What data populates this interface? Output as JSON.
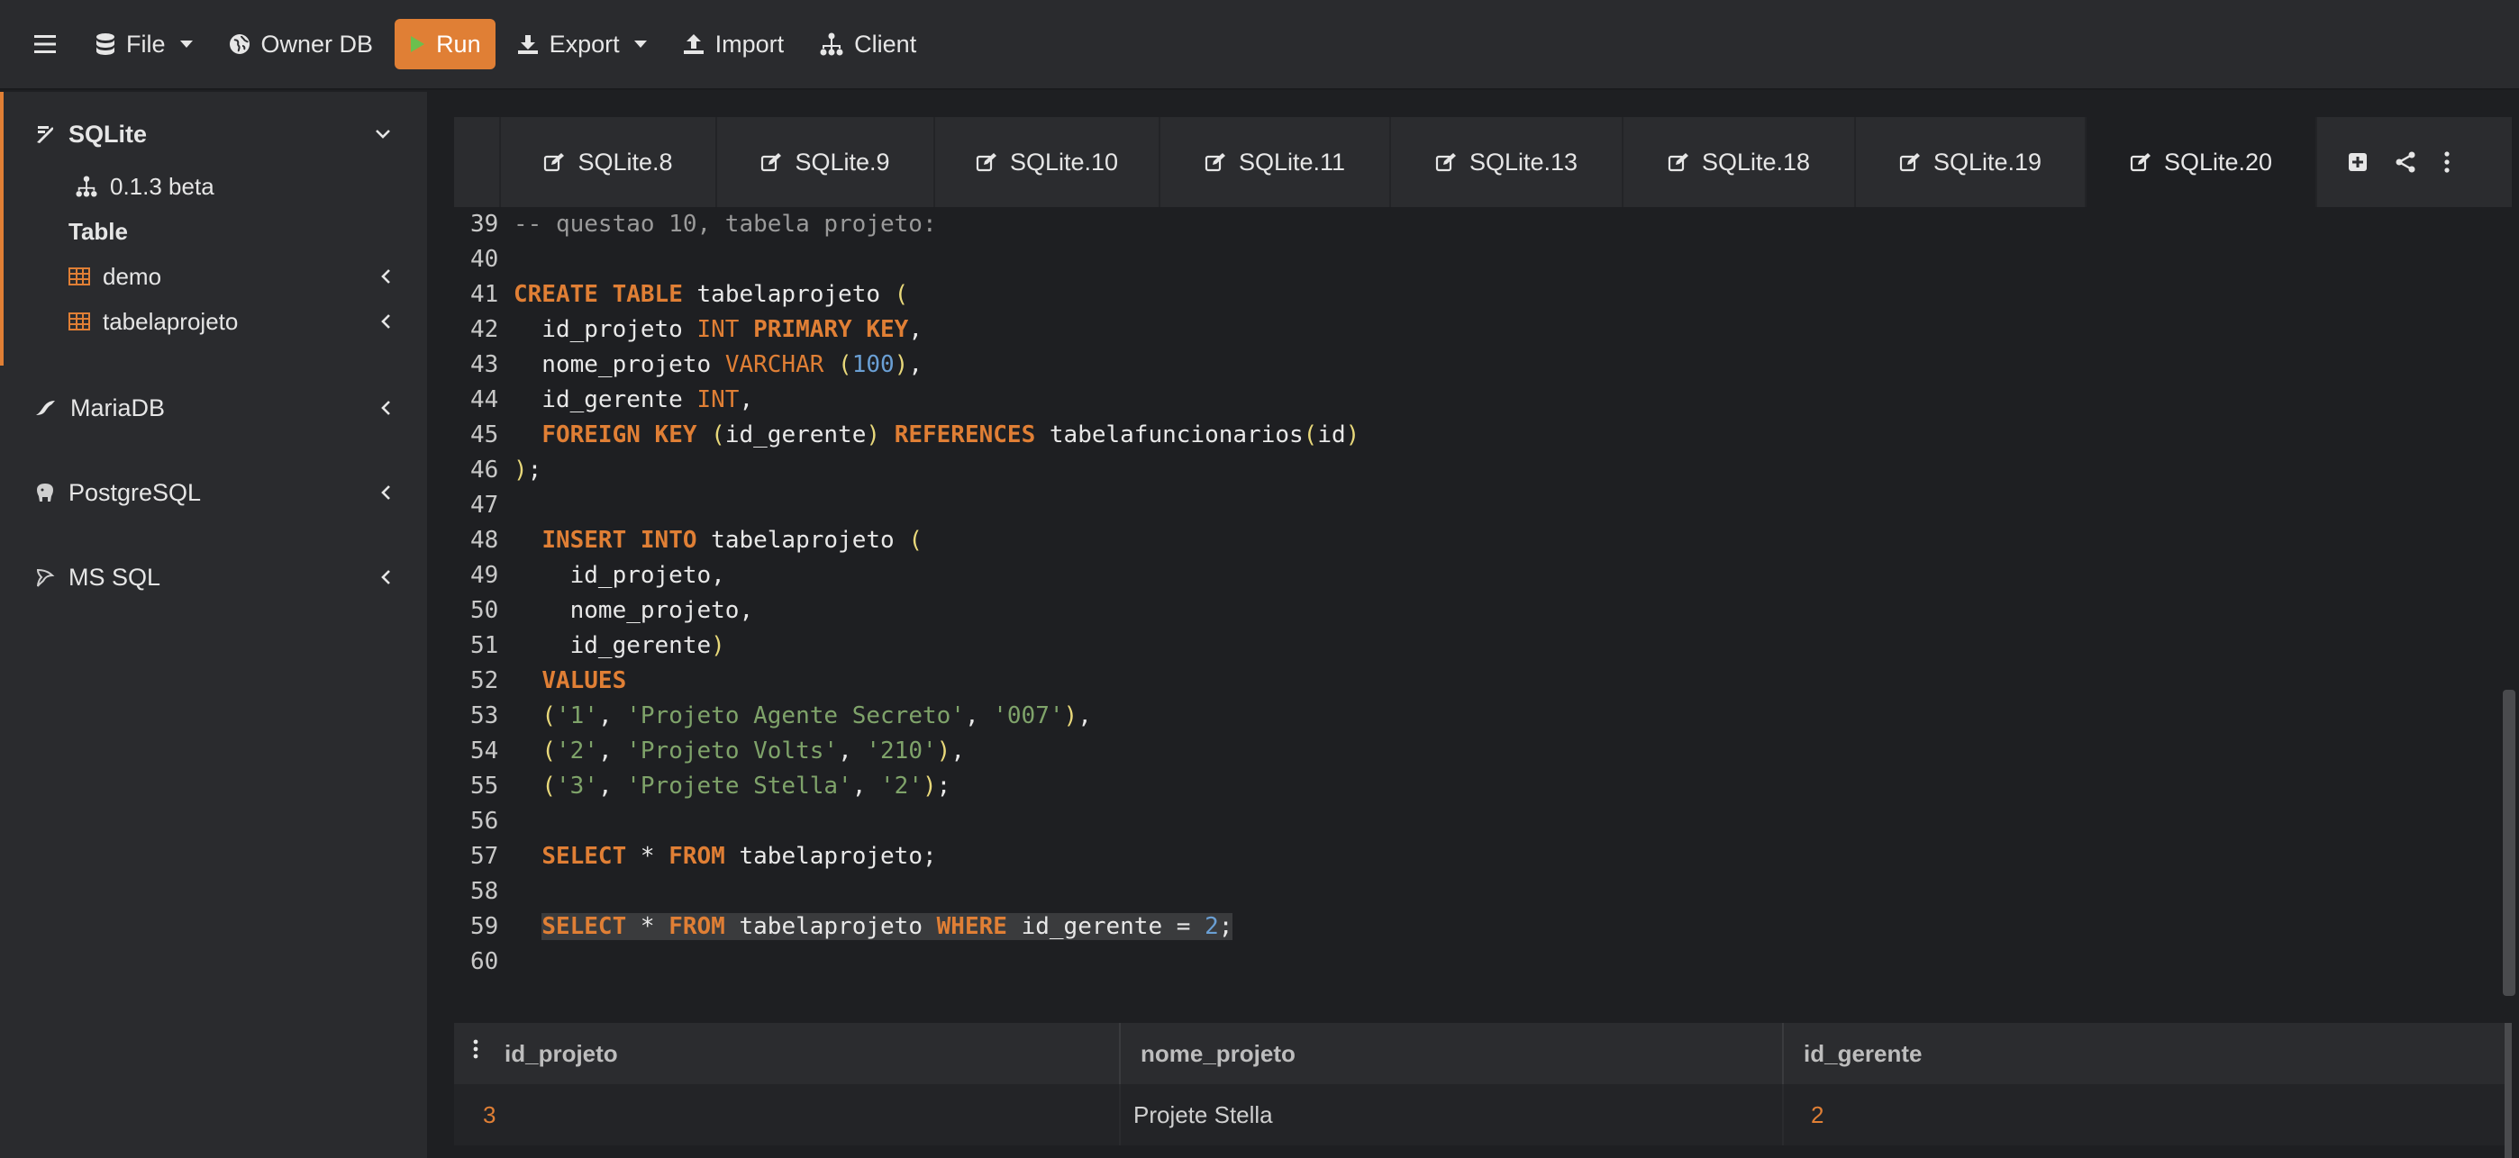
{
  "toolbar": {
    "file": "File",
    "owner_db": "Owner DB",
    "run": "Run",
    "export": "Export",
    "import": "Import",
    "client": "Client"
  },
  "sidebar": {
    "sqlite": {
      "label": "SQLite",
      "version": "0.1.3 beta",
      "section": "Table",
      "tables": [
        "demo",
        "tabelaprojeto"
      ]
    },
    "mariadb": "MariaDB",
    "postgresql": "PostgreSQL",
    "mssql": "MS SQL"
  },
  "tabs": [
    "SQLite.8",
    "SQLite.9",
    "SQLite.10",
    "SQLite.11",
    "SQLite.13",
    "SQLite.18",
    "SQLite.19",
    "SQLite.20"
  ],
  "active_tab": "SQLite.20",
  "editor": {
    "lines": [
      {
        "n": "39",
        "t": "-- questao 10, tabela projeto:"
      },
      {
        "n": "40",
        "t": ""
      },
      {
        "n": "41",
        "t": "CREATE TABLE tabelaprojeto ("
      },
      {
        "n": "42",
        "t": "  id_projeto INT PRIMARY KEY,"
      },
      {
        "n": "43",
        "t": "  nome_projeto VARCHAR (100),"
      },
      {
        "n": "44",
        "t": "  id_gerente INT,"
      },
      {
        "n": "45",
        "t": "  FOREIGN KEY (id_gerente) REFERENCES tabelafuncionarios(id)"
      },
      {
        "n": "46",
        "t": ");"
      },
      {
        "n": "47",
        "t": ""
      },
      {
        "n": "48",
        "t": "  INSERT INTO tabelaprojeto ("
      },
      {
        "n": "49",
        "t": "    id_projeto,"
      },
      {
        "n": "50",
        "t": "    nome_projeto,"
      },
      {
        "n": "51",
        "t": "    id_gerente)"
      },
      {
        "n": "52",
        "t": "  VALUES"
      },
      {
        "n": "53",
        "t": "  ('1', 'Projeto Agente Secreto', '007'),"
      },
      {
        "n": "54",
        "t": "  ('2', 'Projeto Volts', '210'),"
      },
      {
        "n": "55",
        "t": "  ('3', 'Projete Stella', '2');"
      },
      {
        "n": "56",
        "t": ""
      },
      {
        "n": "57",
        "t": "  SELECT * FROM tabelaprojeto;"
      },
      {
        "n": "58",
        "t": ""
      },
      {
        "n": "59",
        "t": "  SELECT * FROM tabelaprojeto WHERE id_gerente = 2;"
      },
      {
        "n": "60",
        "t": ""
      }
    ]
  },
  "results": {
    "columns": [
      "id_projeto",
      "nome_projeto",
      "id_gerente"
    ],
    "rows": [
      {
        "id_projeto": "3",
        "nome_projeto": "Projete Stella",
        "id_gerente": "2"
      }
    ]
  },
  "colors": {
    "accent": "#e07f35",
    "keyword": "#e07f35",
    "number": "#6a9fd4",
    "string": "#7fa36a",
    "comment": "#9a9a9a"
  }
}
